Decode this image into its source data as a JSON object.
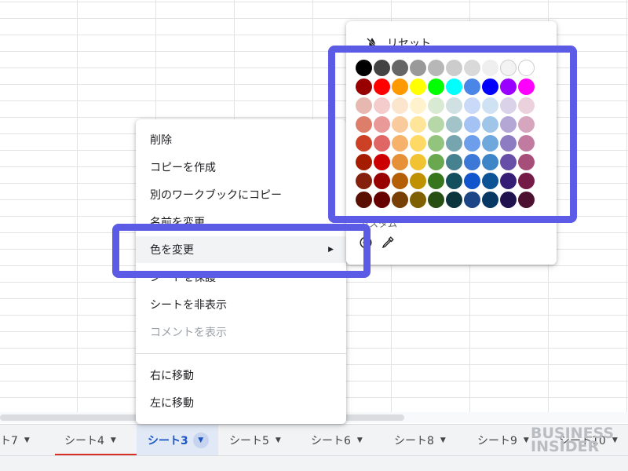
{
  "context_menu": {
    "items": [
      {
        "label": "削除",
        "state": "normal"
      },
      {
        "label": "コピーを作成",
        "state": "normal"
      },
      {
        "label": "別のワークブックにコピー",
        "state": "normal",
        "submenu": true
      },
      {
        "label": "名前を変更",
        "state": "normal"
      },
      {
        "label": "色を変更",
        "state": "hover",
        "submenu": true
      },
      {
        "label": "シートを保護",
        "state": "normal"
      },
      {
        "label": "シートを非表示",
        "state": "normal"
      },
      {
        "label": "コメントを表示",
        "state": "disabled"
      },
      {
        "label": "右に移動",
        "state": "normal"
      },
      {
        "label": "左に移動",
        "state": "normal"
      }
    ]
  },
  "color_palette": {
    "reset_label": "リセット",
    "custom_label": "カスタム",
    "reset_icon": "format-color-reset-icon",
    "add_icon": "add-circle-icon",
    "picker_icon": "eyedropper-icon",
    "rows": [
      [
        "#000000",
        "#434343",
        "#666666",
        "#999999",
        "#b7b7b7",
        "#cccccc",
        "#d9d9d9",
        "#efefef",
        "#f3f3f3",
        "#ffffff"
      ],
      [
        "#980000",
        "#ff0000",
        "#ff9900",
        "#ffff00",
        "#00ff00",
        "#00ffff",
        "#4a86e8",
        "#0000ff",
        "#9900ff",
        "#ff00ff"
      ],
      [
        "#e6b8af",
        "#f4cccc",
        "#fce5cd",
        "#fff2cc",
        "#d9ead3",
        "#d0e0e3",
        "#c9daf8",
        "#cfe2f3",
        "#d9d2e9",
        "#ead1dc"
      ],
      [
        "#dd7e6b",
        "#ea9999",
        "#f9cb9c",
        "#ffe599",
        "#b6d7a8",
        "#a2c4c9",
        "#a4c2f4",
        "#9fc5e8",
        "#b4a7d6",
        "#d5a6bd"
      ],
      [
        "#cc4125",
        "#e06666",
        "#f6b26b",
        "#ffd966",
        "#93c47d",
        "#76a5af",
        "#6d9eeb",
        "#6fa8dc",
        "#8e7cc3",
        "#c27ba0"
      ],
      [
        "#a61c00",
        "#cc0000",
        "#e69138",
        "#f1c232",
        "#6aa84f",
        "#45818e",
        "#3c78d8",
        "#3d85c6",
        "#674ea7",
        "#a64d79"
      ],
      [
        "#85200c",
        "#990000",
        "#b45f06",
        "#bf9000",
        "#38761d",
        "#134f5c",
        "#1155cc",
        "#0b5394",
        "#351c75",
        "#741b47"
      ],
      [
        "#5b0f00",
        "#660000",
        "#783f04",
        "#7f6000",
        "#274e13",
        "#0c343d",
        "#1c4587",
        "#073763",
        "#20124d",
        "#4c1130"
      ]
    ]
  },
  "sheet_tabs": [
    {
      "label": "ト7"
    },
    {
      "label": "シート4",
      "colored": "#d93025"
    },
    {
      "label": "シート3",
      "active": true
    },
    {
      "label": "シート5"
    },
    {
      "label": "シート6"
    },
    {
      "label": "シート8"
    },
    {
      "label": "シート9"
    },
    {
      "label": "シート10"
    }
  ],
  "watermark": {
    "line1": "BUSINESS",
    "line2": "INSIDER"
  },
  "highlight_color": "#5b5be6"
}
